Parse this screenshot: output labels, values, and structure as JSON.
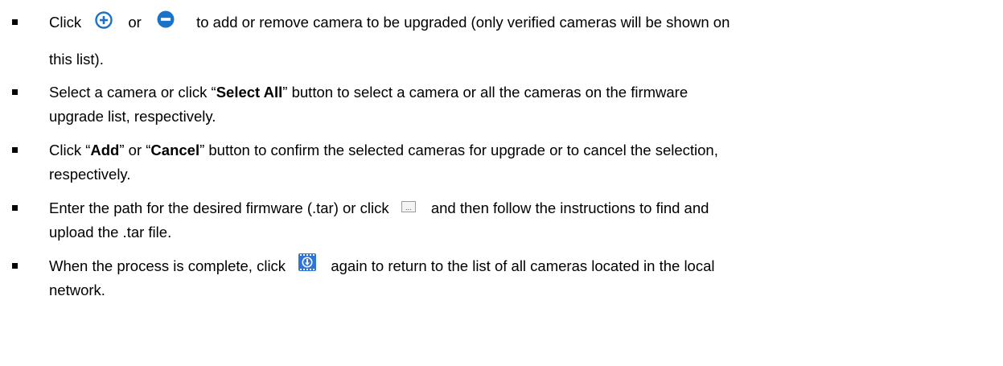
{
  "instructions": {
    "item1": {
      "pre": "Click",
      "or": "or",
      "post": "to add or remove camera to be upgraded (only verified cameras will be shown on",
      "line2": "this list).",
      "add_icon": "plus-circle-icon",
      "remove_icon": "minus-circle-icon"
    },
    "item2": {
      "pre": "Select a camera or click “",
      "bold": "Select All",
      "post": "” button to select a camera or all the cameras on the firmware",
      "line2": "upgrade list, respectively."
    },
    "item3": {
      "pre": "Click “",
      "bold1": "Add",
      "mid": "” or “",
      "bold2": "Cancel",
      "post": "” button to confirm the selected cameras for upgrade or to cancel the selection,",
      "line2": "respectively."
    },
    "item4": {
      "pre": "Enter the path for the desired firmware (.tar) or click",
      "post": "and then follow the instructions to find and",
      "line2": "upload the .tar file.",
      "browse_icon": "browse-ellipsis-icon",
      "browse_glyph": "..."
    },
    "item5": {
      "pre": "When the process is complete, click",
      "post": "again to return to the list of all cameras located in the local",
      "line2": "network.",
      "upgrade_icon": "firmware-upgrade-icon"
    }
  },
  "colors": {
    "text": "#000000",
    "icon_blue": "#1a73c8",
    "icon_upgrade": "#2f74d8"
  }
}
